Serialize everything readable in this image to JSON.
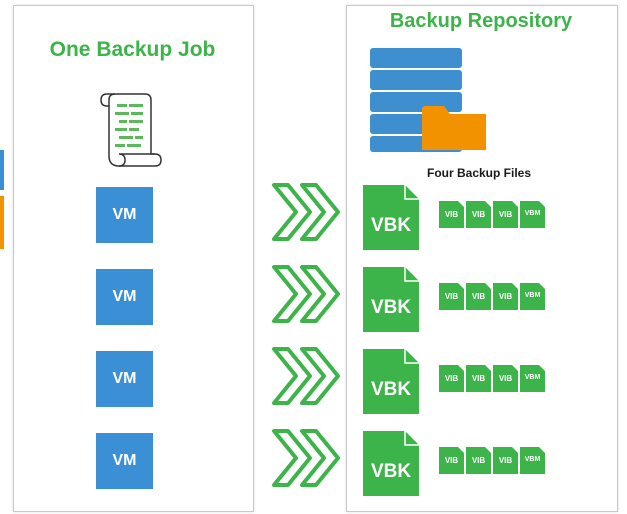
{
  "left": {
    "title": "One Backup Job",
    "vm_label": "VM"
  },
  "right": {
    "title": "Backup Repository",
    "files_label": "Four Backup Files",
    "full_label": "VBK",
    "incremental_label": "VIB",
    "metadata_label": "VBM"
  },
  "colors": {
    "title_green": "#3cb449",
    "vm_blue": "#3b8fd4",
    "server_blue": "#3d8fcf",
    "folder_orange": "#f39200",
    "file_green": "#3cb449",
    "chevron_green": "#3cb449",
    "script_green": "#5cb85c"
  },
  "icons": {
    "job": "script-scroll-icon",
    "repository": "server-stack-icon",
    "folder": "folder-icon",
    "flow": "double-chevron-icon",
    "file": "file-icon"
  }
}
